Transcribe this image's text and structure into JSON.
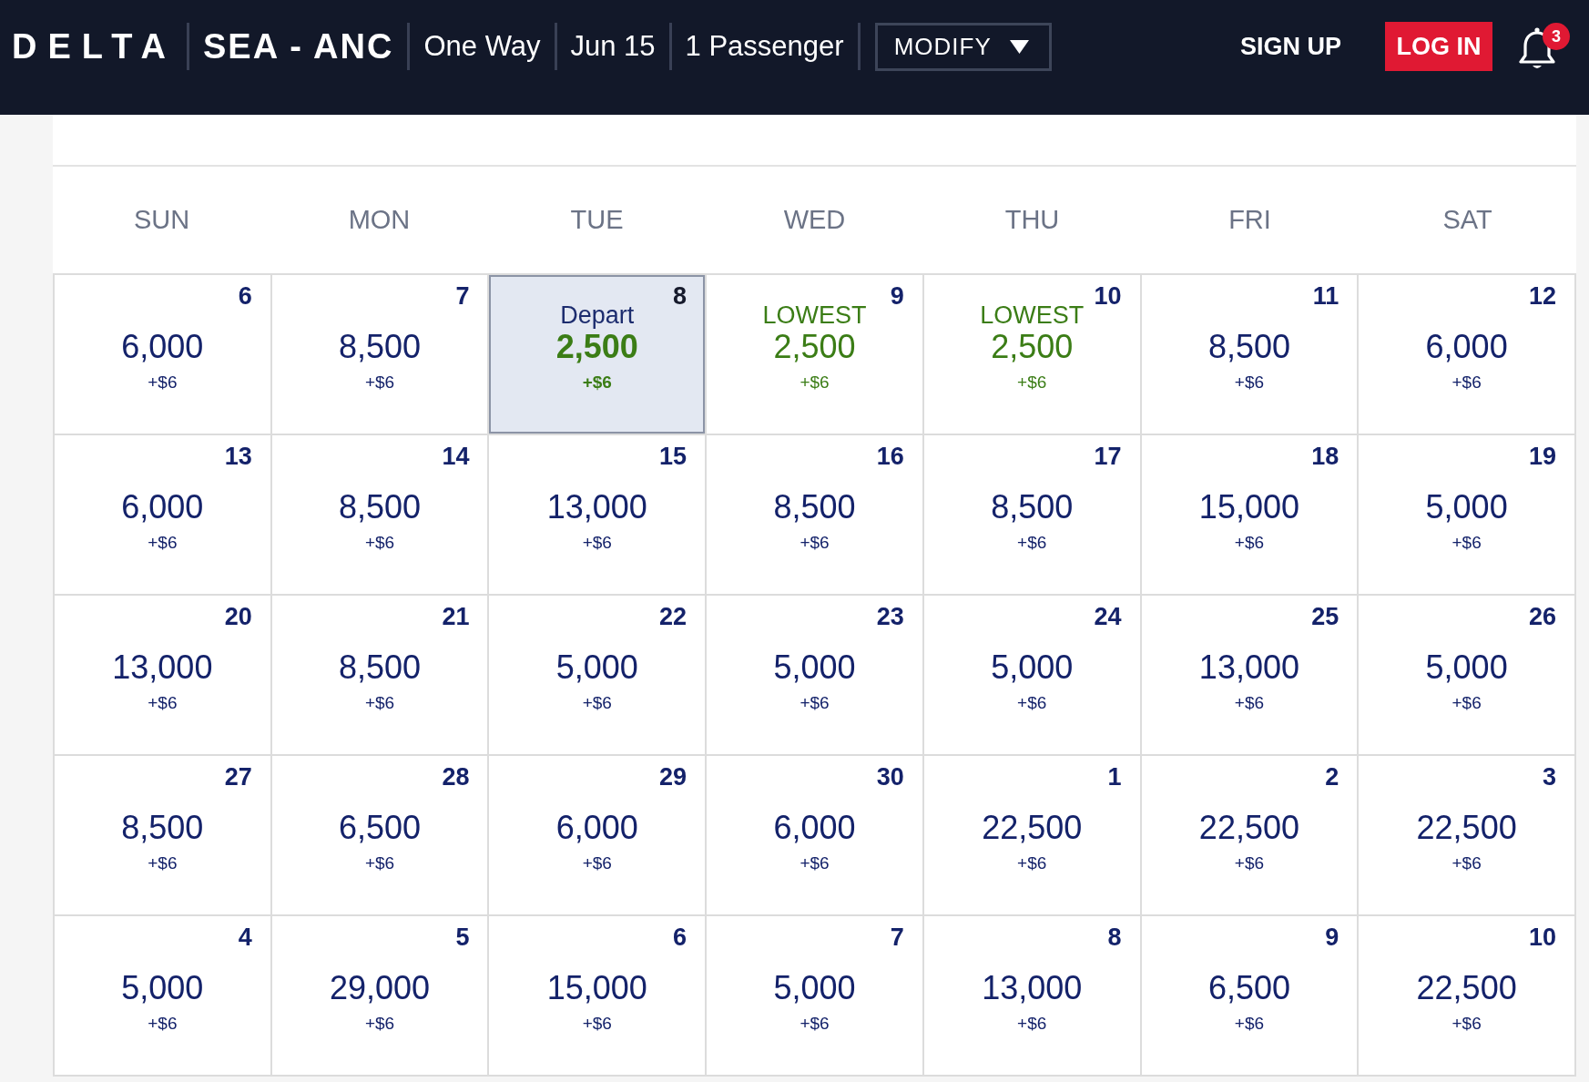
{
  "header": {
    "logo": "DELTA",
    "route": "SEA - ANC",
    "summary": [
      "One Way",
      "Jun 15",
      "1 Passenger"
    ],
    "modify_button": "MODIFY",
    "sign_up": "SIGN UP",
    "log_in": "LOG IN",
    "notification_count": "3"
  },
  "calendar": {
    "weekdays": [
      "SUN",
      "MON",
      "TUE",
      "WED",
      "THU",
      "FRI",
      "SAT"
    ],
    "weeks": [
      [
        {
          "day": "6",
          "price": "6,000",
          "fee": "+$6",
          "selected": false,
          "lowest": false
        },
        {
          "day": "7",
          "price": "8,500",
          "fee": "+$6",
          "selected": false,
          "lowest": false
        },
        {
          "day": "8",
          "label": "Depart",
          "price": "2,500",
          "fee": "+$6",
          "selected": true,
          "lowest": true
        },
        {
          "day": "9",
          "label": "LOWEST",
          "price": "2,500",
          "fee": "+$6",
          "selected": false,
          "lowest": true
        },
        {
          "day": "10",
          "label": "LOWEST",
          "price": "2,500",
          "fee": "+$6",
          "selected": false,
          "lowest": true
        },
        {
          "day": "11",
          "price": "8,500",
          "fee": "+$6",
          "selected": false,
          "lowest": false
        },
        {
          "day": "12",
          "price": "6,000",
          "fee": "+$6",
          "selected": false,
          "lowest": false
        }
      ],
      [
        {
          "day": "13",
          "price": "6,000",
          "fee": "+$6",
          "selected": false,
          "lowest": false
        },
        {
          "day": "14",
          "price": "8,500",
          "fee": "+$6",
          "selected": false,
          "lowest": false
        },
        {
          "day": "15",
          "price": "13,000",
          "fee": "+$6",
          "selected": false,
          "lowest": false
        },
        {
          "day": "16",
          "price": "8,500",
          "fee": "+$6",
          "selected": false,
          "lowest": false
        },
        {
          "day": "17",
          "price": "8,500",
          "fee": "+$6",
          "selected": false,
          "lowest": false
        },
        {
          "day": "18",
          "price": "15,000",
          "fee": "+$6",
          "selected": false,
          "lowest": false
        },
        {
          "day": "19",
          "price": "5,000",
          "fee": "+$6",
          "selected": false,
          "lowest": false
        }
      ],
      [
        {
          "day": "20",
          "price": "13,000",
          "fee": "+$6",
          "selected": false,
          "lowest": false
        },
        {
          "day": "21",
          "price": "8,500",
          "fee": "+$6",
          "selected": false,
          "lowest": false
        },
        {
          "day": "22",
          "price": "5,000",
          "fee": "+$6",
          "selected": false,
          "lowest": false
        },
        {
          "day": "23",
          "price": "5,000",
          "fee": "+$6",
          "selected": false,
          "lowest": false
        },
        {
          "day": "24",
          "price": "5,000",
          "fee": "+$6",
          "selected": false,
          "lowest": false
        },
        {
          "day": "25",
          "price": "13,000",
          "fee": "+$6",
          "selected": false,
          "lowest": false
        },
        {
          "day": "26",
          "price": "5,000",
          "fee": "+$6",
          "selected": false,
          "lowest": false
        }
      ],
      [
        {
          "day": "27",
          "price": "8,500",
          "fee": "+$6",
          "selected": false,
          "lowest": false
        },
        {
          "day": "28",
          "price": "6,500",
          "fee": "+$6",
          "selected": false,
          "lowest": false
        },
        {
          "day": "29",
          "price": "6,000",
          "fee": "+$6",
          "selected": false,
          "lowest": false
        },
        {
          "day": "30",
          "price": "6,000",
          "fee": "+$6",
          "selected": false,
          "lowest": false
        },
        {
          "day": "1",
          "price": "22,500",
          "fee": "+$6",
          "selected": false,
          "lowest": false
        },
        {
          "day": "2",
          "price": "22,500",
          "fee": "+$6",
          "selected": false,
          "lowest": false
        },
        {
          "day": "3",
          "price": "22,500",
          "fee": "+$6",
          "selected": false,
          "lowest": false
        }
      ],
      [
        {
          "day": "4",
          "price": "5,000",
          "fee": "+$6",
          "selected": false,
          "lowest": false
        },
        {
          "day": "5",
          "price": "29,000",
          "fee": "+$6",
          "selected": false,
          "lowest": false
        },
        {
          "day": "6",
          "price": "15,000",
          "fee": "+$6",
          "selected": false,
          "lowest": false
        },
        {
          "day": "7",
          "price": "5,000",
          "fee": "+$6",
          "selected": false,
          "lowest": false
        },
        {
          "day": "8",
          "price": "13,000",
          "fee": "+$6",
          "selected": false,
          "lowest": false
        },
        {
          "day": "9",
          "price": "6,500",
          "fee": "+$6",
          "selected": false,
          "lowest": false
        },
        {
          "day": "10",
          "price": "22,500",
          "fee": "+$6",
          "selected": false,
          "lowest": false
        }
      ]
    ]
  }
}
